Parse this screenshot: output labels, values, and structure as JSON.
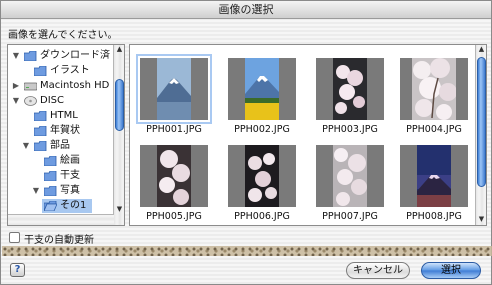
{
  "window": {
    "title": "画像の選択"
  },
  "prompt": "画像を選んでください。",
  "tree": {
    "items": [
      {
        "label": "ダウンロード済",
        "expanded": true,
        "icon": "folder-icon"
      },
      {
        "label": "イラスト",
        "expanded": null,
        "icon": "folder-icon"
      },
      {
        "label": "Macintosh HD",
        "expanded": false,
        "icon": "hard-drive-icon"
      },
      {
        "label": "DISC",
        "expanded": true,
        "icon": "disc-icon"
      },
      {
        "label": "HTML",
        "expanded": null,
        "icon": "folder-icon"
      },
      {
        "label": "年賀状",
        "expanded": null,
        "icon": "folder-icon"
      },
      {
        "label": "部品",
        "expanded": true,
        "icon": "folder-icon"
      },
      {
        "label": "絵画",
        "expanded": null,
        "icon": "folder-icon"
      },
      {
        "label": "干支",
        "expanded": null,
        "icon": "folder-icon"
      },
      {
        "label": "写真",
        "expanded": true,
        "icon": "folder-icon"
      },
      {
        "label": "その1",
        "expanded": null,
        "icon": "open-folder-icon",
        "selected": true
      }
    ]
  },
  "grid": {
    "items": [
      {
        "caption": "PPH001.JPG",
        "subject": "mount-fuji-lake",
        "selected": true
      },
      {
        "caption": "PPH002.JPG",
        "subject": "mount-fuji-flowers"
      },
      {
        "caption": "PPH003.JPG",
        "subject": "cherry-blossom"
      },
      {
        "caption": "PPH004.JPG",
        "subject": "cherry-blossom-tree"
      },
      {
        "caption": "PPH005.JPG",
        "subject": "cherry-blossom-closeup"
      },
      {
        "caption": "PPH006.JPG",
        "subject": "cherry-blossom-dark"
      },
      {
        "caption": "PPH007.JPG",
        "subject": "cherry-blossom-branch"
      },
      {
        "caption": "PPH008.JPG",
        "subject": "mount-fuji-dusk"
      }
    ]
  },
  "auto_update": {
    "label": "干支の自動更新",
    "checked": false
  },
  "buttons": {
    "help": "?",
    "cancel": "キャンセル",
    "ok": "選択"
  },
  "colors": {
    "accent": "#3d7bd4",
    "selection": "#a8c8f0"
  }
}
